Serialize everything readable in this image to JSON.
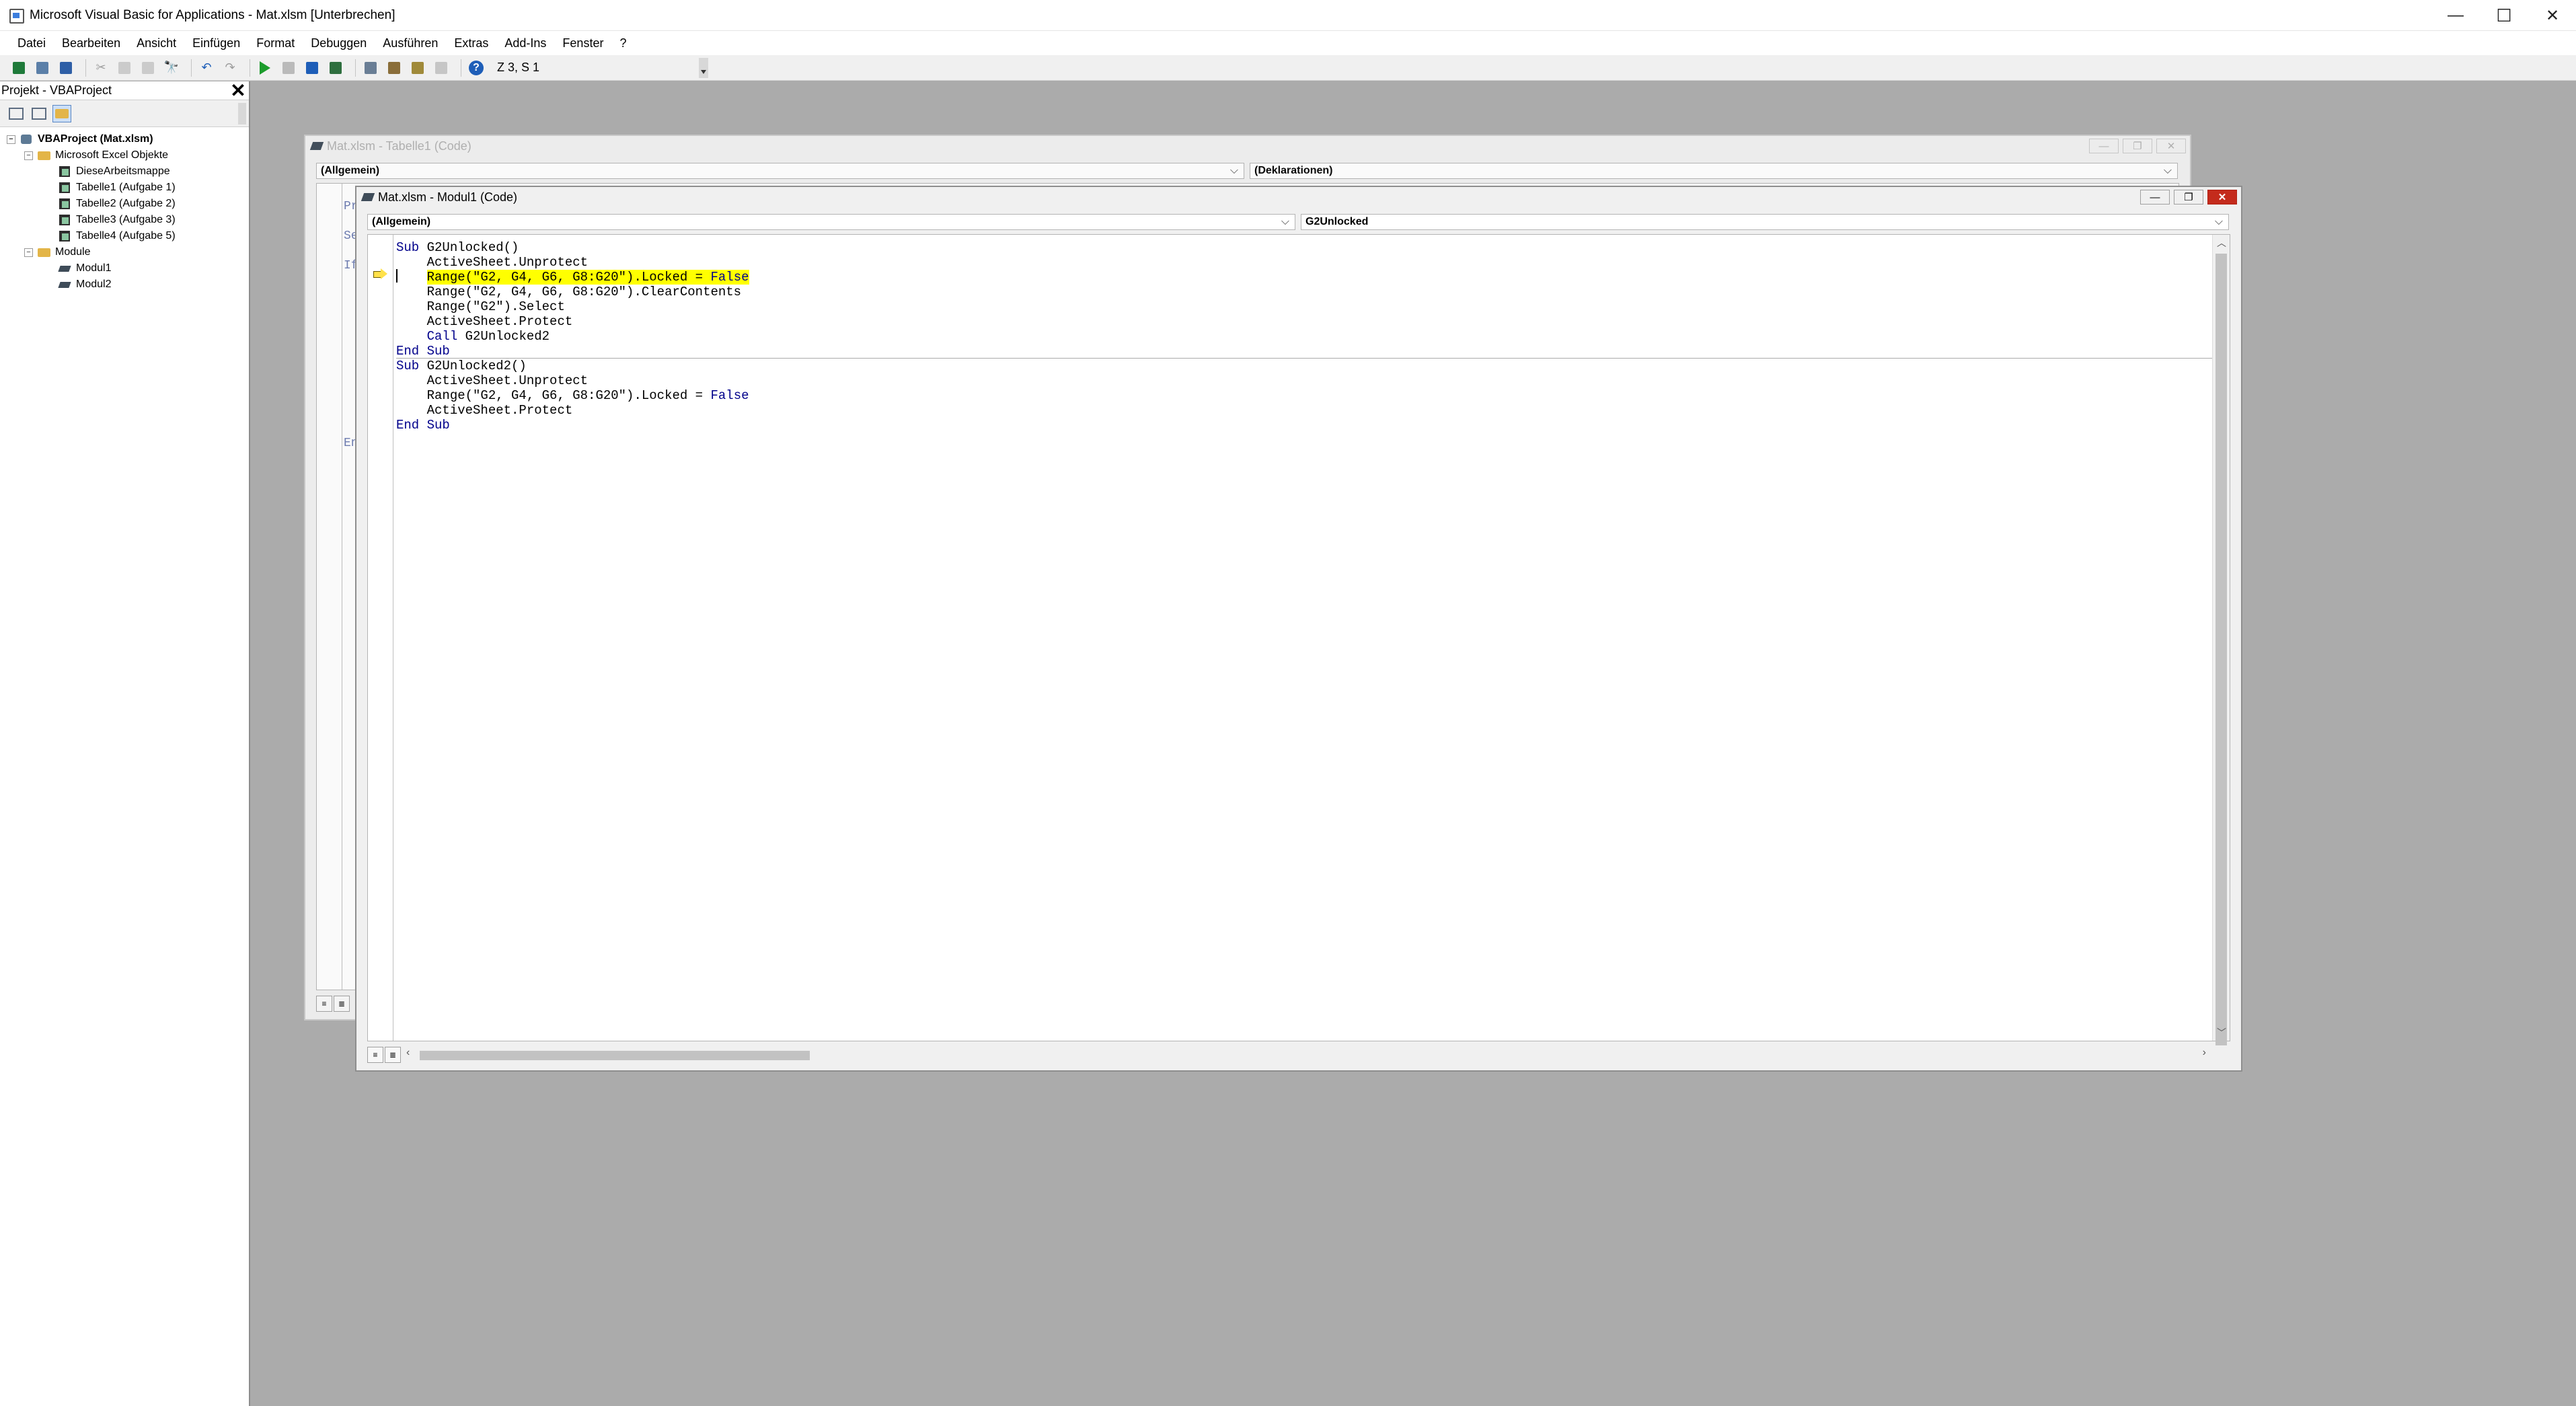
{
  "window": {
    "title": "Microsoft Visual Basic for Applications - Mat.xlsm [Unterbrechen]",
    "minimize": "—",
    "maximize": "☐",
    "close": "✕"
  },
  "menu": [
    "Datei",
    "Bearbeiten",
    "Ansicht",
    "Einfügen",
    "Format",
    "Debuggen",
    "Ausführen",
    "Extras",
    "Add-Ins",
    "Fenster",
    "?"
  ],
  "toolbar": {
    "position": "Z 3, S 1"
  },
  "project": {
    "title": "Projekt - VBAProject",
    "close": "✕",
    "tree": {
      "root": "VBAProject (Mat.xlsm)",
      "excel_objects": "Microsoft Excel Objekte",
      "workbook": "DieseArbeitsmappe",
      "sheets": [
        "Tabelle1 (Aufgabe 1)",
        "Tabelle2 (Aufgabe 2)",
        "Tabelle3 (Aufgabe 3)",
        "Tabelle4 (Aufgabe 5)"
      ],
      "modules_folder": "Module",
      "modules": [
        "Modul1",
        "Modul2"
      ]
    }
  },
  "back_window": {
    "title": "Mat.xlsm - Tabelle1 (Code)",
    "object_combo": "(Allgemein)",
    "proc_combo": "(Deklarationen)",
    "ghost_lines": [
      "Pr",
      "Se",
      "If",
      "En"
    ]
  },
  "front_window": {
    "title": "Mat.xlsm - Modul1 (Code)",
    "object_combo": "(Allgemein)",
    "proc_combo": "G2Unlocked",
    "code": [
      {
        "kw1": "Sub ",
        "text": "G2Unlocked()",
        "kw2": "",
        "hl": false,
        "indent": ""
      },
      {
        "kw1": "",
        "text": "ActiveSheet.Unprotect",
        "kw2": "",
        "hl": false,
        "indent": "    "
      },
      {
        "kw1": "",
        "text": "Range(\"G2, G4, G6, G8:G20\").Locked = ",
        "kw2": "False",
        "hl": true,
        "indent": "    "
      },
      {
        "kw1": "",
        "text": "Range(\"G2, G4, G6, G8:G20\").ClearContents",
        "kw2": "",
        "hl": false,
        "indent": "    "
      },
      {
        "kw1": "",
        "text": "Range(\"G2\").Select",
        "kw2": "",
        "hl": false,
        "indent": "    "
      },
      {
        "kw1": "",
        "text": "ActiveSheet.Protect",
        "kw2": "",
        "hl": false,
        "indent": "    "
      },
      {
        "kw1": "Call ",
        "text": "G2Unlocked2",
        "kw2": "",
        "hl": false,
        "indent": "    "
      },
      {
        "kw1": "End Sub",
        "text": "",
        "kw2": "",
        "hl": false,
        "indent": ""
      },
      {
        "kw1": "Sub ",
        "text": "G2Unlocked2()",
        "kw2": "",
        "hl": false,
        "indent": ""
      },
      {
        "kw1": "",
        "text": "ActiveSheet.Unprotect",
        "kw2": "",
        "hl": false,
        "indent": "    "
      },
      {
        "kw1": "",
        "text": "Range(\"G2, G4, G6, G8:G20\").Locked = ",
        "kw2": "False",
        "hl": false,
        "indent": "    "
      },
      {
        "kw1": "",
        "text": "ActiveSheet.Protect",
        "kw2": "",
        "hl": false,
        "indent": "    "
      },
      {
        "kw1": "End Sub",
        "text": "",
        "kw2": "",
        "hl": false,
        "indent": ""
      }
    ]
  },
  "colors": {
    "keyword": "#00008b",
    "highlight": "#ffff00",
    "mdi_background": "#ababab",
    "close_button": "#c42b1c"
  }
}
